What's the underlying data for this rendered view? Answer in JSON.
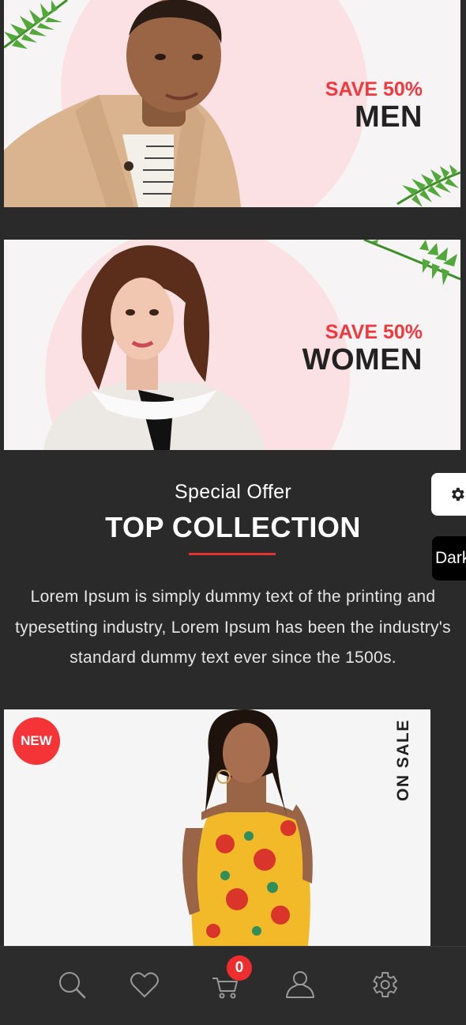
{
  "banners": [
    {
      "save_label": "SAVE 50%",
      "category": "MEN"
    },
    {
      "save_label": "SAVE 50%",
      "category": "WOMEN"
    }
  ],
  "collection": {
    "subtitle": "Special Offer",
    "title": "TOP COLLECTION",
    "description": "Lorem Ipsum is simply dummy text of the printing and typesetting industry, Lorem Ipsum has been the industry's standard dummy text ever since the 1500s."
  },
  "side_controls": {
    "theme_toggle_label": "Dark",
    "settings_icon": "gear-icon"
  },
  "product": {
    "badge": "NEW",
    "ribbon": "ON SALE"
  },
  "bottom_nav": {
    "items": [
      "search-icon",
      "heart-icon",
      "cart-icon",
      "user-icon",
      "gear-icon"
    ],
    "cart_count": "0"
  },
  "colors": {
    "accent": "#f0393f",
    "background": "#2a2a2a",
    "banner_circle": "#fbe1e3"
  }
}
